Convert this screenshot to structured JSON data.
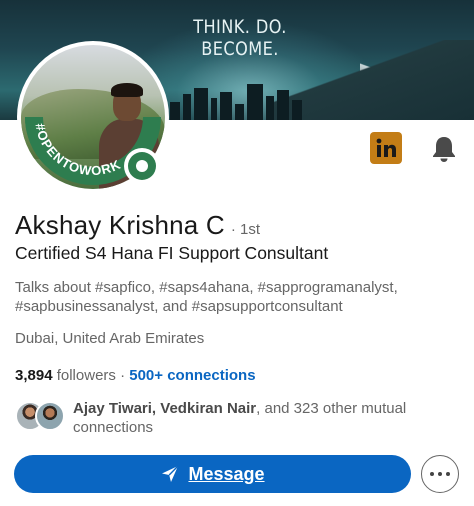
{
  "banner": {
    "tagline": "THINK. DO. BECOME."
  },
  "profile": {
    "avatar_ring_text": "#OPENTOWORK",
    "name": "Akshay Krishna C",
    "degree": "· 1st",
    "headline": "Certified S4 Hana FI Support Consultant",
    "talks_about": "Talks about #sapfico, #saps4ahana, #sapprogramanalyst, #sapbusinessanalyst, and #sapsupportconsultant",
    "location": "Dubai, United Arab Emirates"
  },
  "stats": {
    "followers_count": "3,894",
    "followers_label": "followers",
    "separator": "·",
    "connections": "500+ connections"
  },
  "mutual": {
    "names": "Ajay Tiwari, Vedkiran Nair",
    "rest": ", and 323 other mutual connections"
  },
  "actions": {
    "message_label": "Message",
    "more_icon": "more-horizontal-icon",
    "send_icon": "paper-plane-icon"
  },
  "icons": {
    "linkedin": "linkedin-logo-icon",
    "notification": "bell-icon"
  },
  "colors": {
    "primary_blue": "#0a66c2",
    "open_to_work_green": "#2e7d4f",
    "linkedin_logo_bg": "#c37d16",
    "secondary_text": "#666666"
  }
}
